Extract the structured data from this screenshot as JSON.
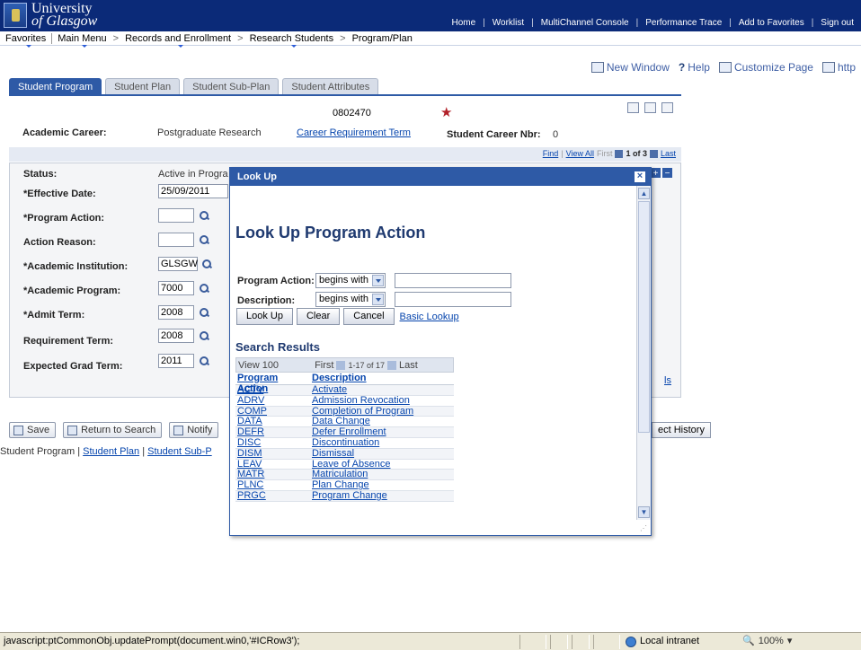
{
  "banner": {
    "logo_line1": "University",
    "logo_line2": "of Glasgow",
    "links": [
      "Home",
      "Worklist",
      "MultiChannel Console",
      "Performance Trace",
      "Add to Favorites",
      "Sign out"
    ]
  },
  "menu": {
    "favorites": "Favorites",
    "main_menu": "Main Menu",
    "crumbs": [
      "Records and Enrollment",
      "Research Students",
      "Program/Plan"
    ]
  },
  "pagetools": {
    "new_window": "New Window",
    "help": "Help",
    "customize": "Customize Page",
    "http": "http"
  },
  "tabs": [
    "Student Program",
    "Student Plan",
    "Student Sub-Plan",
    "Student Attributes"
  ],
  "header": {
    "emplid": "0802470",
    "academic_career_label": "Academic Career:",
    "academic_career_value": "Postgraduate Research",
    "career_req_term_link": "Career Requirement Term",
    "student_career_nbr_label": "Student Career Nbr:",
    "student_career_nbr_value": "0"
  },
  "navrow": {
    "find": "Find",
    "view_all": "View All",
    "first": "First",
    "count": "1 of 3",
    "last": "Last"
  },
  "fields": {
    "status_label": "Status:",
    "status_value": "Active in Progra",
    "effective_date_label": "*Effective Date:",
    "effective_date_value": "25/09/2011",
    "program_action_label": "*Program Action:",
    "action_reason_label": "Action Reason:",
    "academic_institution_label": "*Academic Institution:",
    "academic_institution_value": "GLSGW",
    "academic_program_label": "*Academic Program:",
    "academic_program_value": "7000",
    "admit_term_label": "*Admit Term:",
    "admit_term_value": "2008",
    "requirement_term_label": "Requirement Term:",
    "requirement_term_value": "2008",
    "expected_grad_term_label": "Expected Grad Term:",
    "expected_grad_term_value": "2011",
    "right_partial_link": "ls"
  },
  "bottom": {
    "save": "Save",
    "return_to_search": "Return to Search",
    "notify": "Notify",
    "history_partial": "ect History",
    "link_student_program": "Student Program",
    "link_student_plan": "Student Plan",
    "link_student_sub_partial": "Student Sub-P"
  },
  "modal": {
    "title": "Look Up",
    "heading": "Look Up Program Action",
    "program_action_label": "Program Action:",
    "program_action_operator": "begins with",
    "description_label": "Description:",
    "description_operator": "begins with",
    "lookup_button": "Look Up",
    "clear_button": "Clear",
    "cancel_button": "Cancel",
    "basic_lookup_link": "Basic Lookup",
    "search_results_heading": "Search Results",
    "view_100": "View 100",
    "first": "First",
    "results_count": "1-17 of 17",
    "last": "Last",
    "col_program_action": "Program Action",
    "col_description": "Description",
    "rows": [
      {
        "code": "ACTV",
        "desc": "Activate"
      },
      {
        "code": "ADRV",
        "desc": "Admission Revocation"
      },
      {
        "code": "COMP",
        "desc": "Completion of Program"
      },
      {
        "code": "DATA",
        "desc": "Data Change"
      },
      {
        "code": "DEFR",
        "desc": "Defer Enrollment"
      },
      {
        "code": "DISC",
        "desc": "Discontinuation"
      },
      {
        "code": "DISM",
        "desc": "Dismissal"
      },
      {
        "code": "LEAV",
        "desc": "Leave of Absence"
      },
      {
        "code": "MATR",
        "desc": "Matriculation"
      },
      {
        "code": "PLNC",
        "desc": "Plan Change"
      },
      {
        "code": "PRGC",
        "desc": "Program Change"
      }
    ]
  },
  "statusbar": {
    "message": "javascript:ptCommonObj.updatePrompt(document.win0,'#ICRow3');",
    "zone": "Local intranet",
    "zoom": "100%"
  },
  "colors": {
    "banner": "#0b2a78",
    "accent": "#2e5aa6",
    "required_star": "#b2222a"
  }
}
